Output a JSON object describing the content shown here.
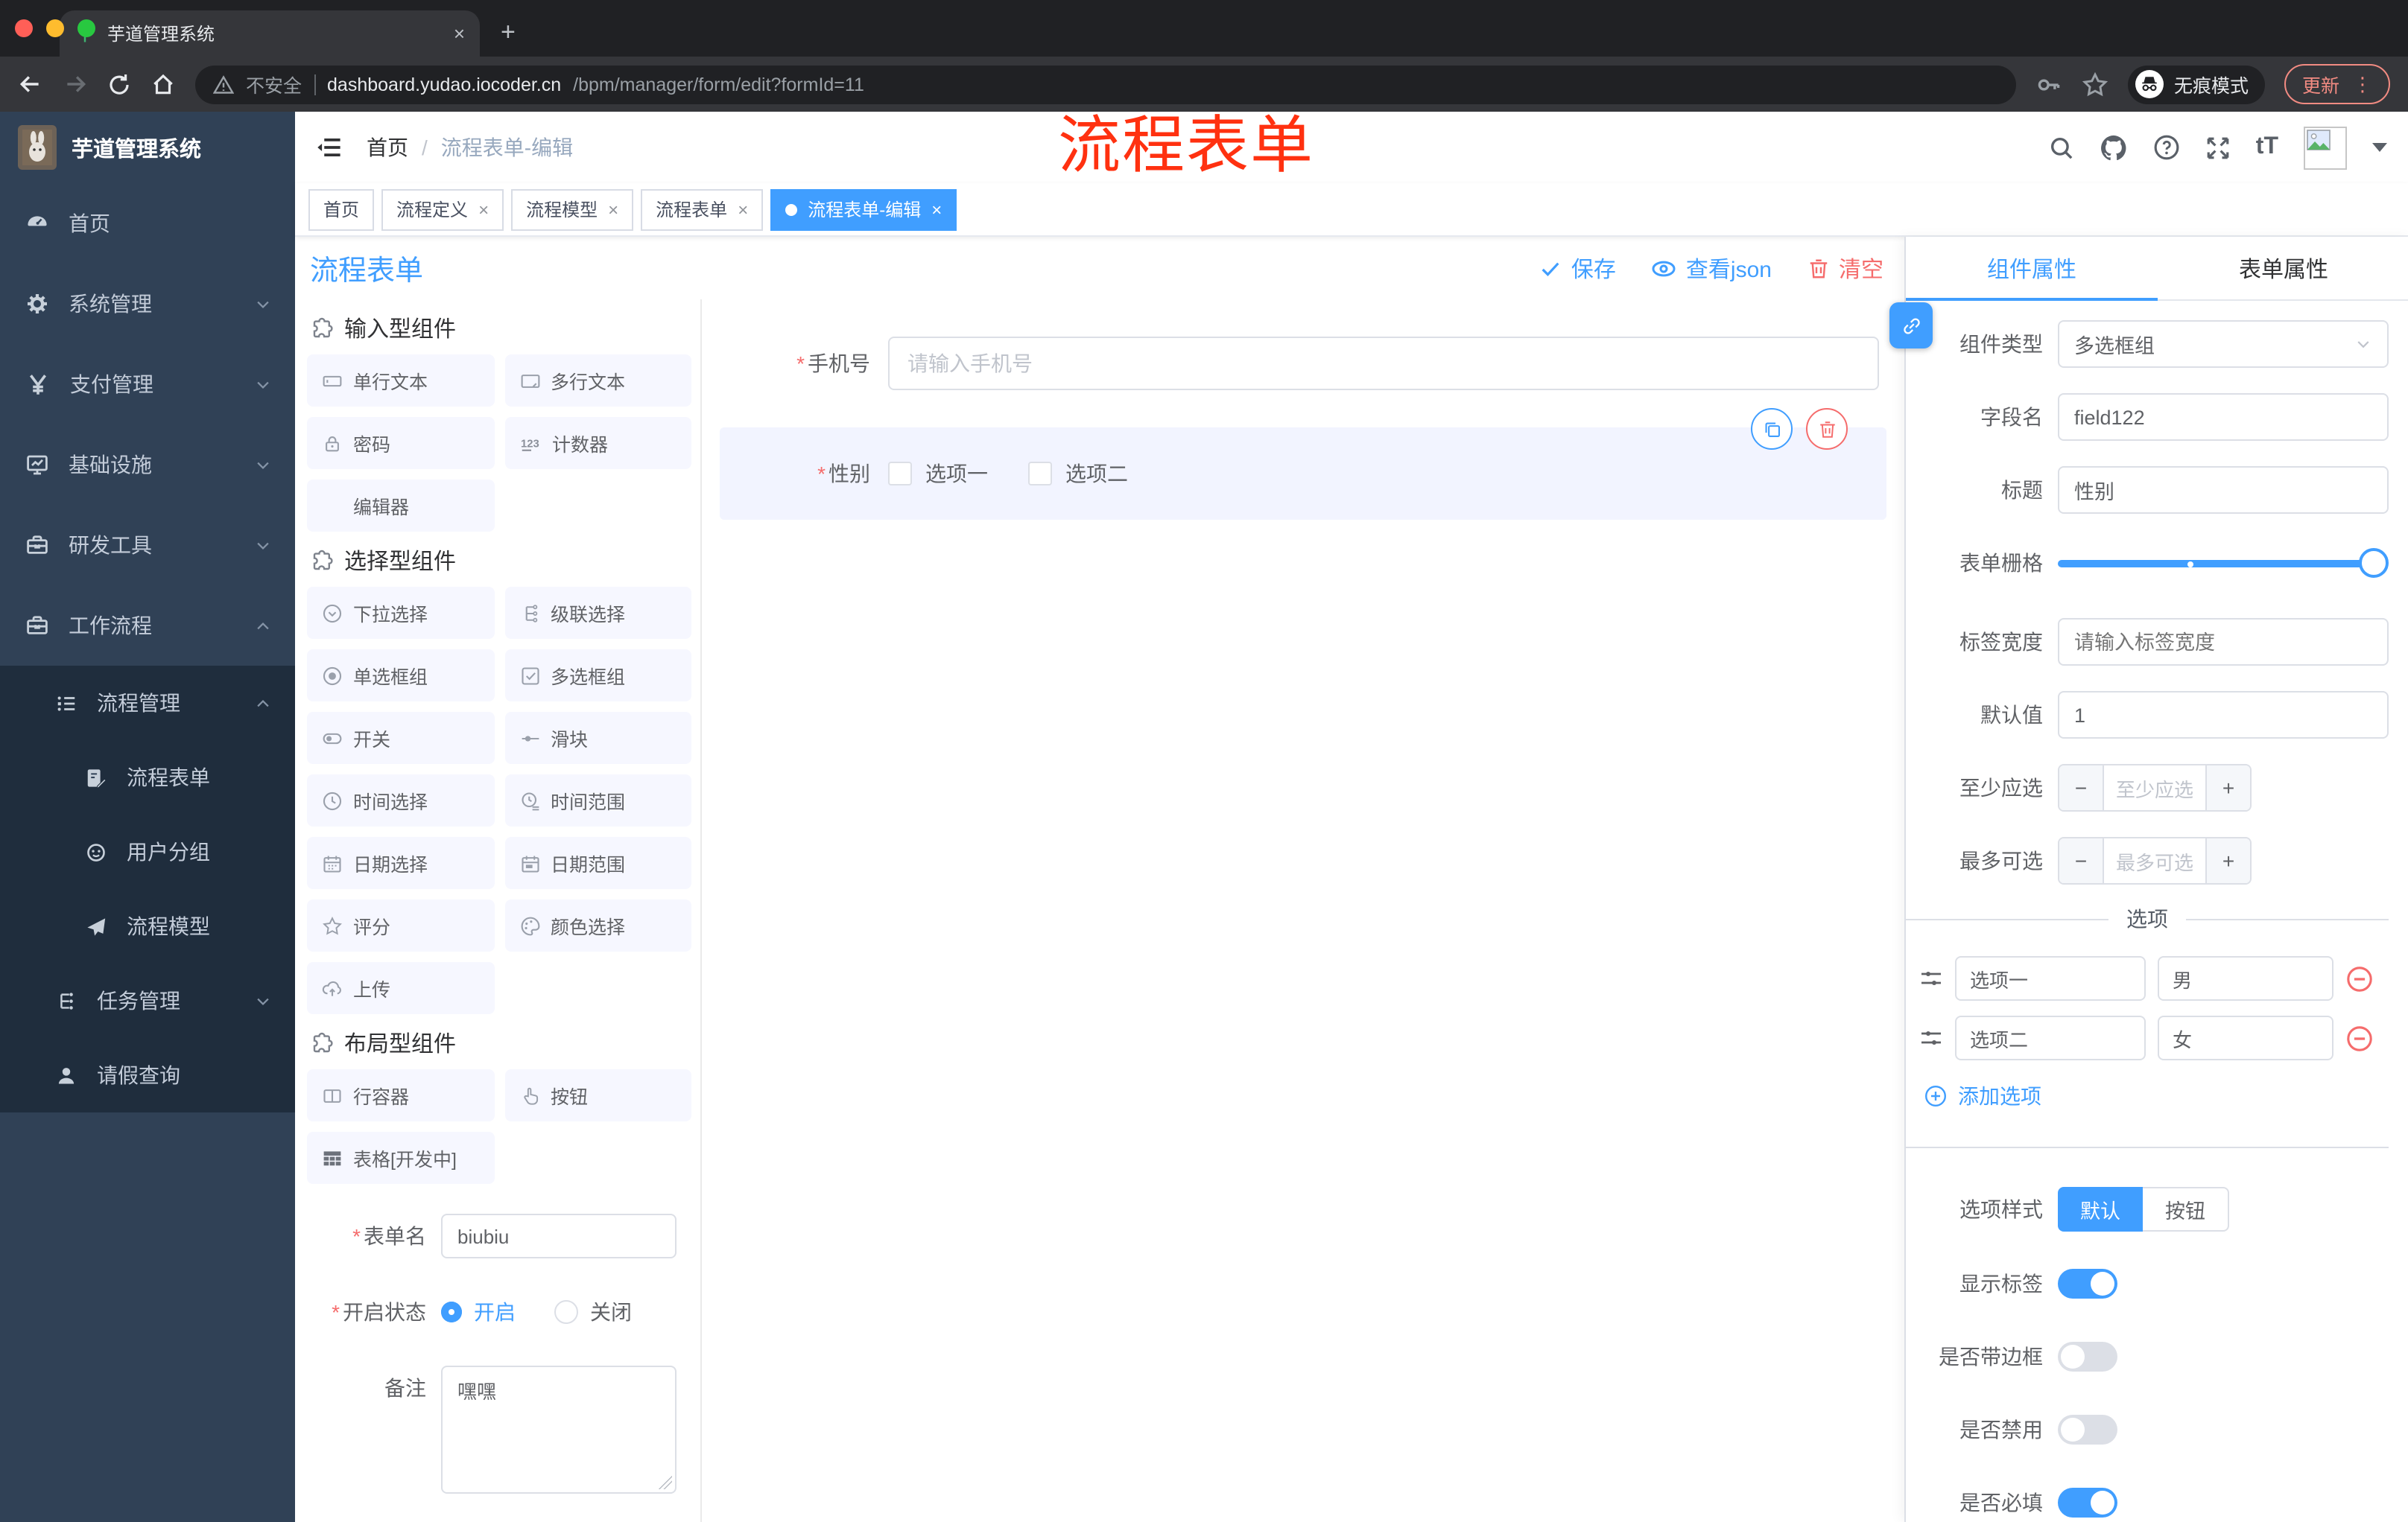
{
  "colors": {
    "accent": "#409EFF",
    "danger": "#F56C6C",
    "annotation_red": "#FF3110",
    "sidebar_bg": "#304156",
    "submenu_bg": "#1F2D3D",
    "chrome_bg": "#202124",
    "toolbar_bg": "#35363A"
  },
  "glyphs": {
    "close": "×",
    "plus": "+",
    "minus": "−",
    "dots": "⋮",
    "slash": "/",
    "font_size": "tT"
  },
  "browser": {
    "tab_title": "芋道管理系统",
    "security_label": "不安全",
    "url_domain": "dashboard.yudao.iocoder.cn",
    "url_path": "/bpm/manager/form/edit?formId=11",
    "incognito_label": "无痕模式",
    "update_label": "更新"
  },
  "sidebar": {
    "logo_title": "芋道管理系统",
    "items": [
      {
        "label": "首页"
      },
      {
        "label": "系统管理"
      },
      {
        "label": "支付管理"
      },
      {
        "label": "基础设施"
      },
      {
        "label": "研发工具"
      },
      {
        "label": "工作流程"
      },
      {
        "label": "流程管理"
      },
      {
        "label": "流程表单"
      },
      {
        "label": "用户分组"
      },
      {
        "label": "流程模型"
      },
      {
        "label": "任务管理"
      },
      {
        "label": "请假查询"
      }
    ]
  },
  "header": {
    "breadcrumb_home": "首页",
    "breadcrumb_current": "流程表单-编辑",
    "annotation": "流程表单"
  },
  "tags": [
    {
      "label": "首页"
    },
    {
      "label": "流程定义"
    },
    {
      "label": "流程模型"
    },
    {
      "label": "流程表单"
    },
    {
      "label": "流程表单-编辑"
    }
  ],
  "toolbar": {
    "title": "流程表单",
    "save": "保存",
    "view_json": "查看json",
    "clear": "清空"
  },
  "components_panel": {
    "sections": [
      {
        "title": "输入型组件",
        "items": [
          {
            "label": "单行文本"
          },
          {
            "label": "多行文本"
          },
          {
            "label": "密码"
          },
          {
            "label": "计数器"
          },
          {
            "label": "编辑器"
          }
        ]
      },
      {
        "title": "选择型组件",
        "items": [
          {
            "label": "下拉选择"
          },
          {
            "label": "级联选择"
          },
          {
            "label": "单选框组"
          },
          {
            "label": "多选框组"
          },
          {
            "label": "开关"
          },
          {
            "label": "滑块"
          },
          {
            "label": "时间选择"
          },
          {
            "label": "时间范围"
          },
          {
            "label": "日期选择"
          },
          {
            "label": "日期范围"
          },
          {
            "label": "评分"
          },
          {
            "label": "颜色选择"
          },
          {
            "label": "上传"
          }
        ]
      },
      {
        "title": "布局型组件",
        "items": [
          {
            "label": "行容器"
          },
          {
            "label": "按钮"
          },
          {
            "label": "表格[开发中]"
          }
        ]
      }
    ],
    "form": {
      "name_label": "表单名",
      "name_value": "biubiu",
      "status_label": "开启状态",
      "status_on": "开启",
      "status_off": "关闭",
      "remark_label": "备注",
      "remark_value": "嘿嘿"
    }
  },
  "canvas": {
    "phone_label": "手机号",
    "phone_placeholder": "请输入手机号",
    "gender_label": "性别",
    "gender_option1": "选项一",
    "gender_option2": "选项二"
  },
  "props": {
    "tab_component": "组件属性",
    "tab_form": "表单属性",
    "component_type_label": "组件类型",
    "component_type_value": "多选框组",
    "field_name_label": "字段名",
    "field_name_value": "field122",
    "title_label": "标题",
    "title_value": "性别",
    "grid_label": "表单栅格",
    "label_width_label": "标签宽度",
    "label_width_placeholder": "请输入标签宽度",
    "default_label": "默认值",
    "default_value": "1",
    "min_label": "至少应选",
    "min_placeholder": "至少应选",
    "max_label": "最多可选",
    "max_placeholder": "最多可选",
    "options_title": "选项",
    "options": [
      {
        "label": "选项一",
        "value": "男"
      },
      {
        "label": "选项二",
        "value": "女"
      }
    ],
    "add_option": "添加选项",
    "style_label": "选项样式",
    "style_default": "默认",
    "style_button": "按钮",
    "toggle_show_label": "显示标签",
    "toggle_border": "是否带边框",
    "toggle_disabled": "是否禁用",
    "toggle_required": "是否必填"
  }
}
